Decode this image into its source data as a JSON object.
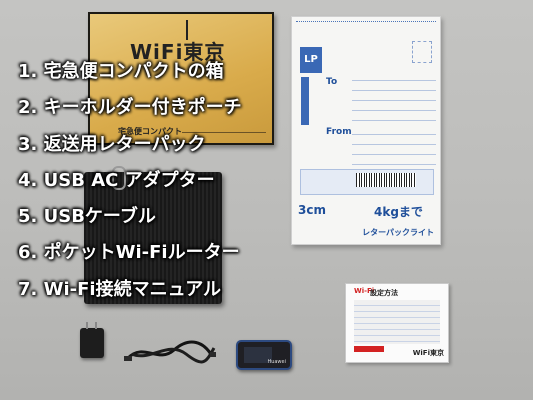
{
  "items": [
    "1. 宅急便コンパクトの箱",
    "2. キーホルダー付きポーチ",
    "3. 返送用レターパック",
    "4. USB AC アダプター",
    "5. USBケーブル",
    "6. ポケットWi-Fiルーター",
    "7. Wi-Fi接続マニュアル"
  ],
  "box": {
    "logo_text": "WiFi東京",
    "footer_label": "宅急便コンパクト"
  },
  "letterpack": {
    "to_label": "To",
    "from_label": "From",
    "logo_text": "LP",
    "limit_thickness": "3cm",
    "limit_weight": "4kgまで",
    "brand": "レターパックライト"
  },
  "manual": {
    "title": "設定方法",
    "wifi_mark": "Wi-Fi",
    "brand": "WiFi東京"
  },
  "router": {
    "brand": "Huawei"
  },
  "colors": {
    "background": "#bcbcba",
    "box_gold": "#d9ab4b",
    "letterpack_blue": "#3a68b5",
    "text_overlay": "#ffffff"
  }
}
